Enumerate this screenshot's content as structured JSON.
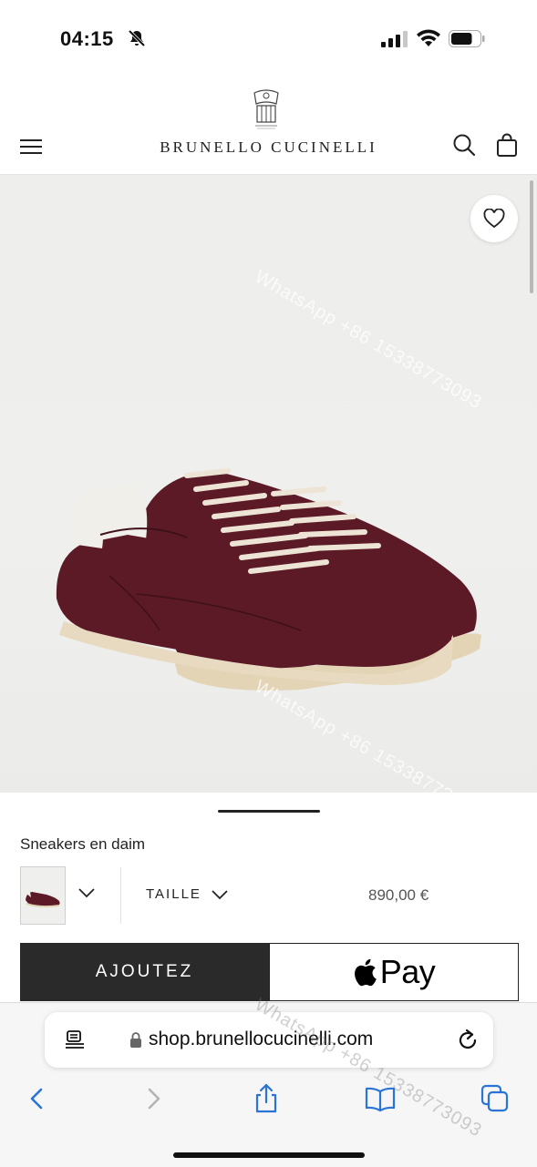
{
  "status_bar": {
    "time": "04:15",
    "battery_level": 0.75
  },
  "header": {
    "brand": "BRUNELLO CUCINELLI"
  },
  "watermark": {
    "text": "WhatsApp +86 15338773093"
  },
  "product": {
    "name": "Sneakers en daim",
    "size_label": "TAILLE",
    "price": "890,00 €",
    "add_label": "AJOUTEZ",
    "pay_label": "Pay",
    "shoe_color": "#5b1a26"
  },
  "browser": {
    "url": "shop.brunellocucinelli.com"
  },
  "icons": [
    "silent-bell-icon",
    "signal-icon",
    "wifi-icon",
    "battery-icon",
    "menu-icon",
    "search-icon",
    "bag-icon",
    "heart-icon",
    "chevron-down-icon",
    "apple-icon",
    "reader-icon",
    "lock-icon",
    "reload-icon",
    "back-icon",
    "forward-icon",
    "share-icon",
    "bookmarks-icon",
    "tabs-icon"
  ]
}
